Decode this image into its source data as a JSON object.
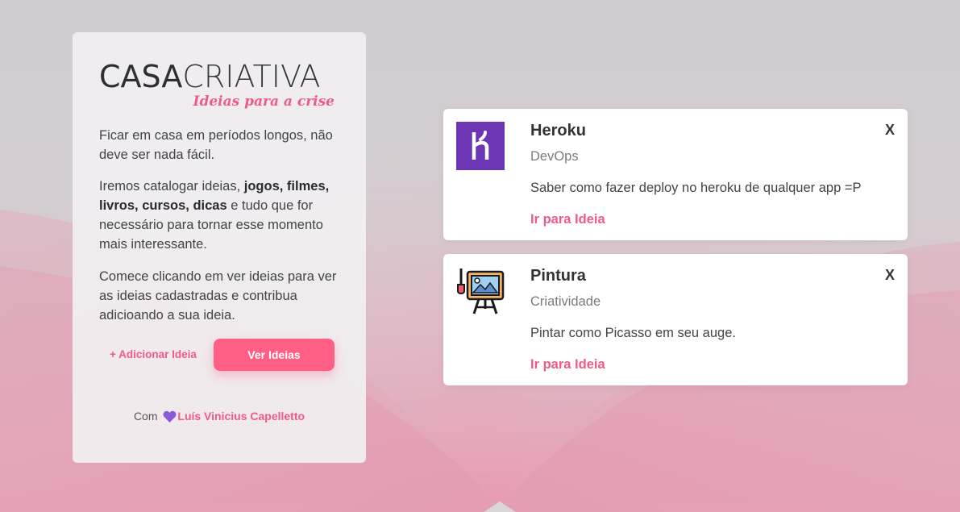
{
  "brand": {
    "title_bold": "CASA",
    "title_light": "CRIATIVA",
    "subtitle": "Ideias para a crise"
  },
  "sidebar": {
    "paragraph1": "Ficar em casa em períodos longos, não deve ser nada fácil.",
    "paragraph2_prefix": "Iremos catalogar ideias, ",
    "paragraph2_bold": "jogos, filmes, livros, cursos, dicas",
    "paragraph2_suffix": " e tudo que for necessário para tornar esse momento mais interessante.",
    "paragraph3": "Comece clicando em ver ideias para ver as ideias cadastradas e contribua adicioando a sua ideia.",
    "add_link_label": "+ Adicionar Ideia",
    "ver_button_label": "Ver Ideias",
    "credit_prefix": "Com",
    "credit_author": "Luís Vinicius Capelletto"
  },
  "ideas": [
    {
      "title": "Heroku",
      "category": "DevOps",
      "description": "Saber como fazer deploy no heroku de qualquer app =P",
      "link_label": "Ir para Ideia",
      "close_label": "X",
      "icon": "heroku-logo-icon"
    },
    {
      "title": "Pintura",
      "category": "Criatividade",
      "description": "Pintar como Picasso em seu auge.",
      "link_label": "Ir para Ideia",
      "close_label": "X",
      "icon": "painting-easel-icon"
    }
  ],
  "colors": {
    "accent": "#ef5a86",
    "button": "#ff5f85",
    "heroku_purple": "#6b35b4",
    "heart": "#8a5ad8"
  }
}
